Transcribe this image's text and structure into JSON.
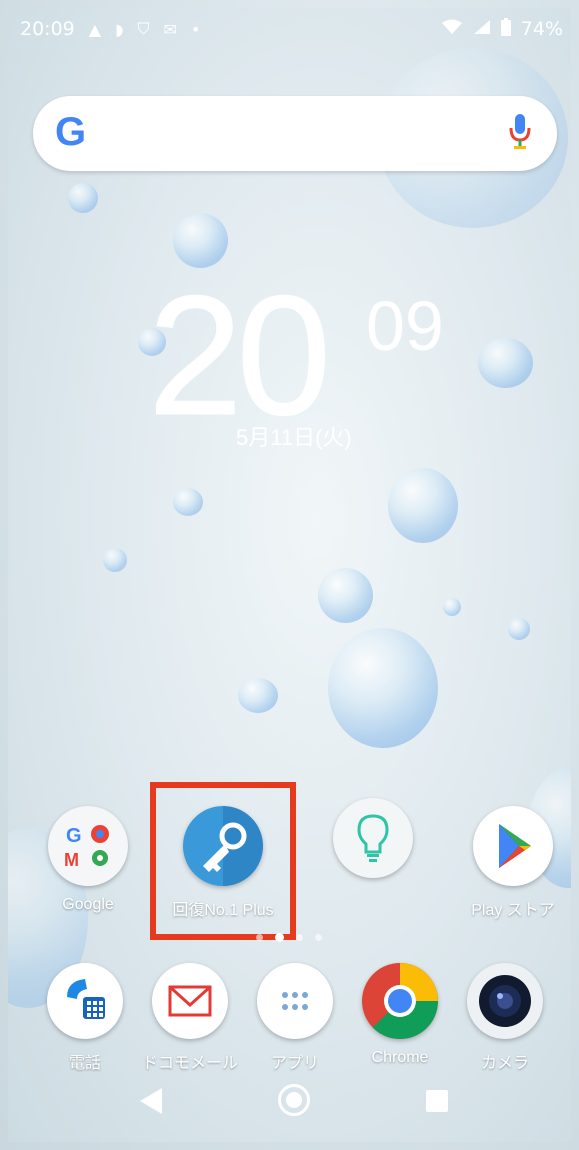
{
  "status_bar": {
    "time": "20:09",
    "battery": "74%",
    "left_icons": [
      "warning-icon",
      "cast-icon",
      "shield-check-icon",
      "gmail-icon",
      "dot-icon"
    ],
    "right_icons": [
      "wifi-icon",
      "signal-icon",
      "battery-icon"
    ]
  },
  "search": {
    "logo_text": "G",
    "icon": "mic-icon"
  },
  "clock": {
    "hour": "20",
    "minute": "09",
    "date": "5月11日(火)"
  },
  "home_row": [
    {
      "label": "Google",
      "icon": "google-folder-icon"
    },
    {
      "label": "回復No.1 Plus",
      "icon": "key-icon"
    },
    {
      "label": "",
      "icon": "lightbulb-icon"
    },
    {
      "label": "Play ストア",
      "icon": "play-store-icon"
    }
  ],
  "dock": [
    {
      "label": "電話",
      "icon": "phone-icon"
    },
    {
      "label": "ドコモメール",
      "icon": "mail-icon"
    },
    {
      "label": "アプリ",
      "icon": "app-drawer-icon"
    },
    {
      "label": "Chrome",
      "icon": "chrome-icon"
    },
    {
      "label": "カメラ",
      "icon": "camera-icon"
    }
  ],
  "page_indicator": {
    "count": 4,
    "active": 2
  },
  "navigation": [
    "back-icon",
    "home-icon",
    "recents-icon"
  ],
  "colors": {
    "highlight": "#e53a1e",
    "key_app": "#3a9ad9",
    "google_blue": "#4285f4"
  }
}
